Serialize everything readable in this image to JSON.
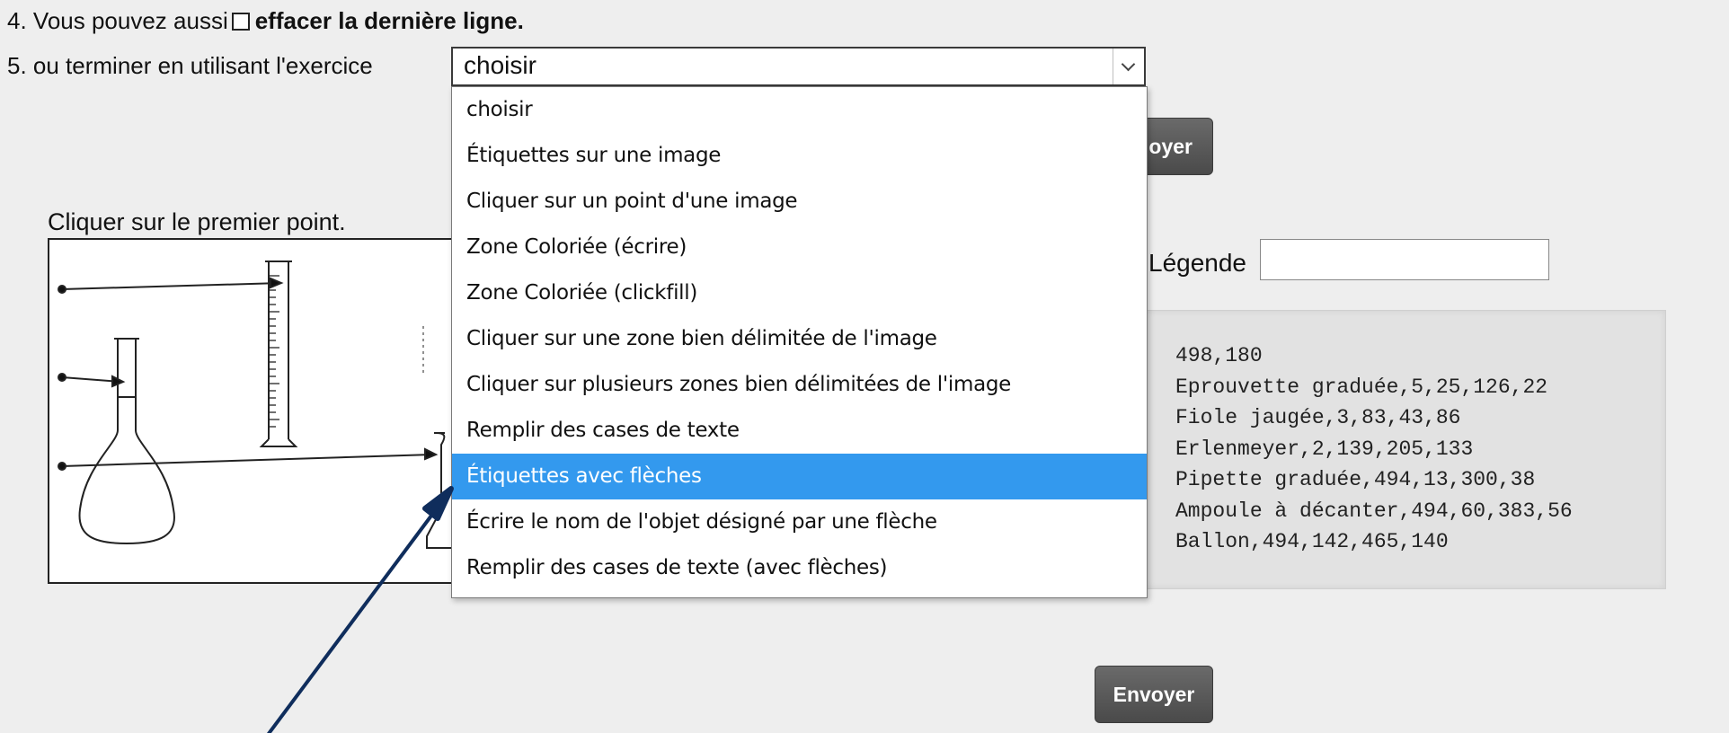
{
  "step4": {
    "text": "4. Vous pouvez aussi",
    "bold": "effacer la dernière ligne."
  },
  "step5": {
    "text": "5. ou terminer en utilisant l'exercice"
  },
  "exercise_select": {
    "value": "choisir",
    "options": [
      "choisir",
      "Étiquettes sur une image",
      "Cliquer sur un point d'une image",
      "Zone Coloriée (écrire)",
      "Zone Coloriée (clickfill)",
      "Cliquer sur une zone bien délimitée de l'image",
      "Cliquer sur plusieurs zones bien délimitées de l'image",
      "Remplir des cases de texte",
      "Étiquettes avec flèches",
      "Écrire le nom de l'objet désigné par une flèche",
      "Remplir des cases de texte (avec flèches)"
    ],
    "highlighted_index": 8
  },
  "buttons": {
    "send_top_visible": "oyer",
    "send_bottom": "Envoyer"
  },
  "instruction": "Cliquer sur le premier point.",
  "legend": {
    "label": "Légende",
    "value": ""
  },
  "code_lines": [
    "498,180",
    "Eprouvette graduée,5,25,126,22",
    "Fiole jaugée,3,83,43,86",
    "Erlenmeyer,2,139,205,133",
    "Pipette graduée,494,13,300,38",
    "Ampoule à décanter,494,60,383,56",
    "Ballon,494,142,465,140"
  ],
  "colors": {
    "page_bg": "#eeeeee",
    "highlight": "#3399ee",
    "button": "#555555",
    "annotation_arrow": "#0f2d5c"
  }
}
